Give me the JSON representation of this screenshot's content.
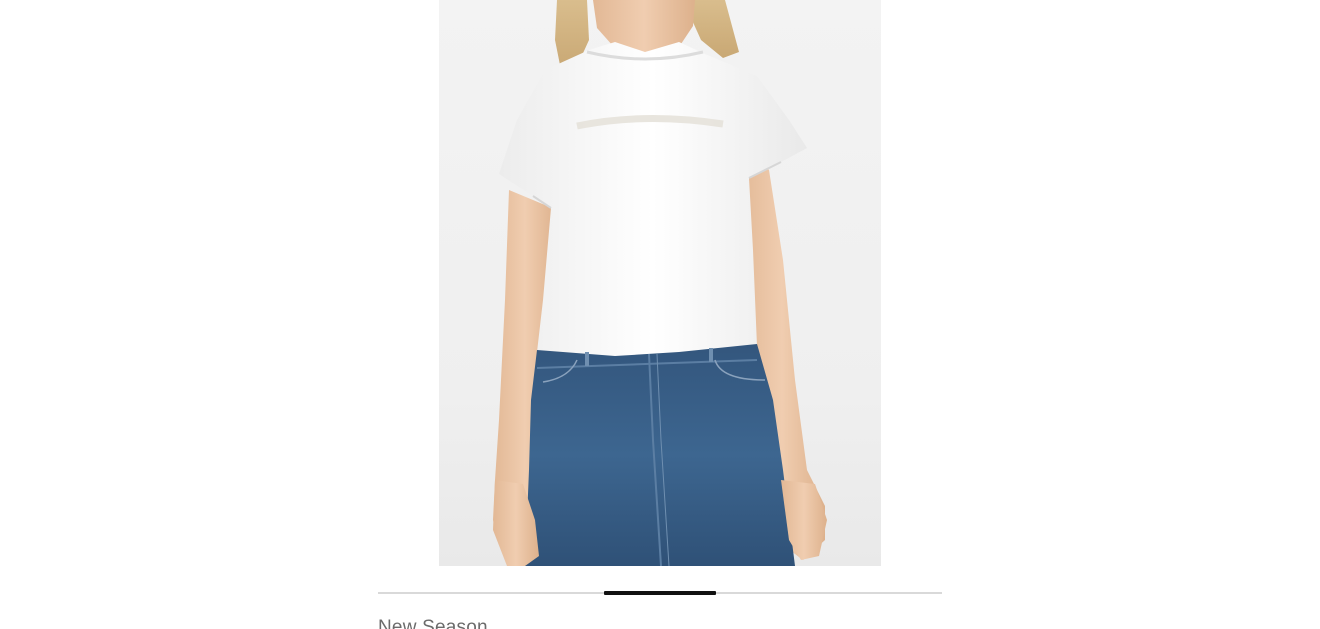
{
  "product": {
    "image": {
      "subject": "woman-in-white-t-shirt-and-denim-skirt",
      "wishlist_icon": "heart-icon"
    },
    "carousel": {
      "slide_count": 5,
      "active_index": 2
    },
    "collection_label": "New Season"
  },
  "colors": {
    "background": "#ffffff",
    "indicator_active": "#111111",
    "indicator_track": "#d9d9d9",
    "label_text": "#6b6b6b"
  }
}
